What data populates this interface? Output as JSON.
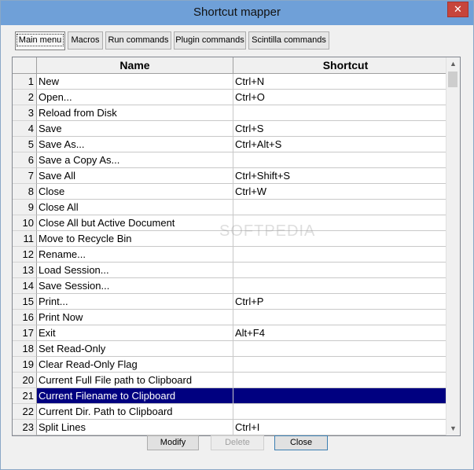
{
  "window": {
    "title": "Shortcut mapper",
    "close_glyph": "✕"
  },
  "tabs": [
    {
      "label": "Main menu"
    },
    {
      "label": "Macros"
    },
    {
      "label": "Run commands"
    },
    {
      "label": "Plugin commands"
    },
    {
      "label": "Scintilla commands"
    }
  ],
  "grid": {
    "headers": {
      "name": "Name",
      "shortcut": "Shortcut"
    },
    "rows": [
      {
        "num": "1",
        "name": "New",
        "shortcut": "Ctrl+N"
      },
      {
        "num": "2",
        "name": "Open...",
        "shortcut": "Ctrl+O"
      },
      {
        "num": "3",
        "name": "Reload from Disk",
        "shortcut": ""
      },
      {
        "num": "4",
        "name": "Save",
        "shortcut": "Ctrl+S"
      },
      {
        "num": "5",
        "name": "Save As...",
        "shortcut": "Ctrl+Alt+S"
      },
      {
        "num": "6",
        "name": "Save a Copy As...",
        "shortcut": ""
      },
      {
        "num": "7",
        "name": "Save All",
        "shortcut": "Ctrl+Shift+S"
      },
      {
        "num": "8",
        "name": "Close",
        "shortcut": "Ctrl+W"
      },
      {
        "num": "9",
        "name": "Close All",
        "shortcut": ""
      },
      {
        "num": "10",
        "name": "Close All but Active Document",
        "shortcut": ""
      },
      {
        "num": "11",
        "name": "Move to Recycle Bin",
        "shortcut": ""
      },
      {
        "num": "12",
        "name": "Rename...",
        "shortcut": ""
      },
      {
        "num": "13",
        "name": "Load Session...",
        "shortcut": ""
      },
      {
        "num": "14",
        "name": "Save Session...",
        "shortcut": ""
      },
      {
        "num": "15",
        "name": "Print...",
        "shortcut": "Ctrl+P"
      },
      {
        "num": "16",
        "name": "Print Now",
        "shortcut": ""
      },
      {
        "num": "17",
        "name": "Exit",
        "shortcut": "Alt+F4"
      },
      {
        "num": "18",
        "name": "Set Read-Only",
        "shortcut": ""
      },
      {
        "num": "19",
        "name": "Clear Read-Only Flag",
        "shortcut": ""
      },
      {
        "num": "20",
        "name": "Current Full File path to Clipboard",
        "shortcut": ""
      },
      {
        "num": "21",
        "name": "Current Filename to Clipboard",
        "shortcut": "",
        "selected": true
      },
      {
        "num": "22",
        "name": "Current Dir. Path to Clipboard",
        "shortcut": ""
      },
      {
        "num": "23",
        "name": "Split Lines",
        "shortcut": "Ctrl+I"
      }
    ]
  },
  "scrollbar": {
    "up_glyph": "▲",
    "down_glyph": "▼"
  },
  "watermark": "SOFTPEDIA",
  "buttons": {
    "modify": "Modify",
    "delete": "Delete",
    "close": "Close"
  }
}
